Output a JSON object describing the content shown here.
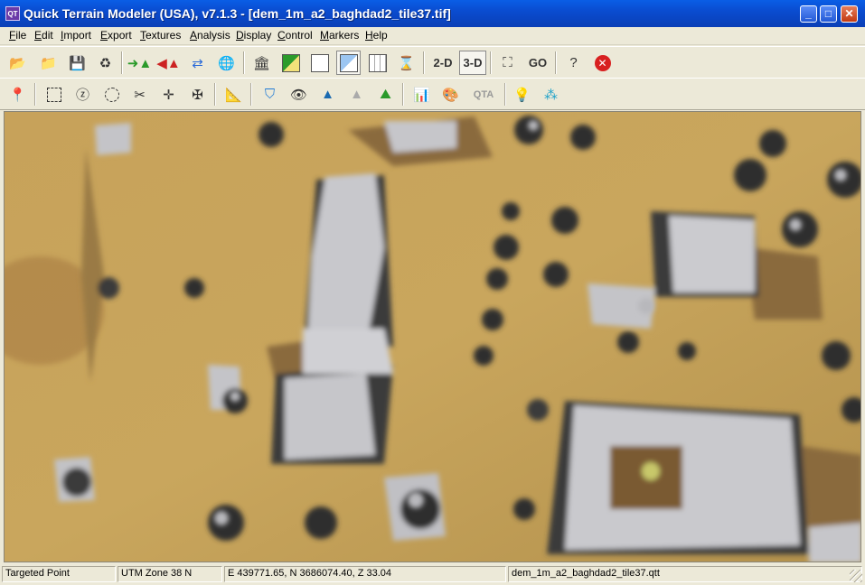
{
  "window": {
    "title": "Quick Terrain Modeler (USA), v7.1.3 - [dem_1m_a2_baghdad2_tile37.tif]",
    "app_icon": "QT"
  },
  "menu": [
    "File",
    "Edit",
    "Import",
    "Export",
    "Textures",
    "Analysis",
    "Display",
    "Control",
    "Markers",
    "Help"
  ],
  "toolbar1": {
    "labels": {
      "two_d": "2-D",
      "three_d": "3-D",
      "go": "GO",
      "help": "?"
    }
  },
  "toolbar2": {
    "qta": "QTA"
  },
  "status": {
    "mode": "Targeted Point",
    "zone": "UTM Zone 38 N",
    "coords": "E 439771.65, N 3686074.40, Z  33.04",
    "file": "dem_1m_a2_baghdad2_tile37.qtt"
  },
  "colors": {
    "ground": "#b8944c",
    "building": "#c8c8cc",
    "shadow": "#3b3b3b",
    "title_bar": "#0a54d8"
  }
}
